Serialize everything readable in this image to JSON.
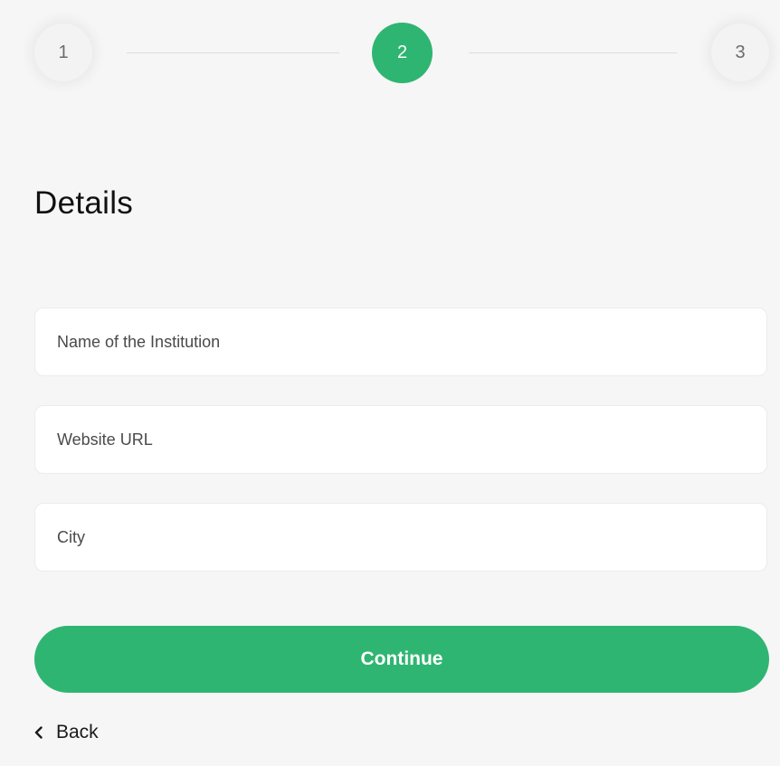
{
  "stepper": {
    "steps": [
      {
        "label": "1",
        "state": "inactive"
      },
      {
        "label": "2",
        "state": "active"
      },
      {
        "label": "3",
        "state": "inactive"
      }
    ]
  },
  "form": {
    "title": "Details",
    "fields": [
      {
        "placeholder": "Name of the Institution",
        "value": ""
      },
      {
        "placeholder": "Website URL",
        "value": ""
      },
      {
        "placeholder": "City",
        "value": ""
      }
    ],
    "continue_label": "Continue",
    "back_label": "Back",
    "back_icon": "chevron-left-icon"
  },
  "colors": {
    "accent": "#2fb572",
    "background": "#f6f6f6",
    "field_background": "#ffffff"
  }
}
